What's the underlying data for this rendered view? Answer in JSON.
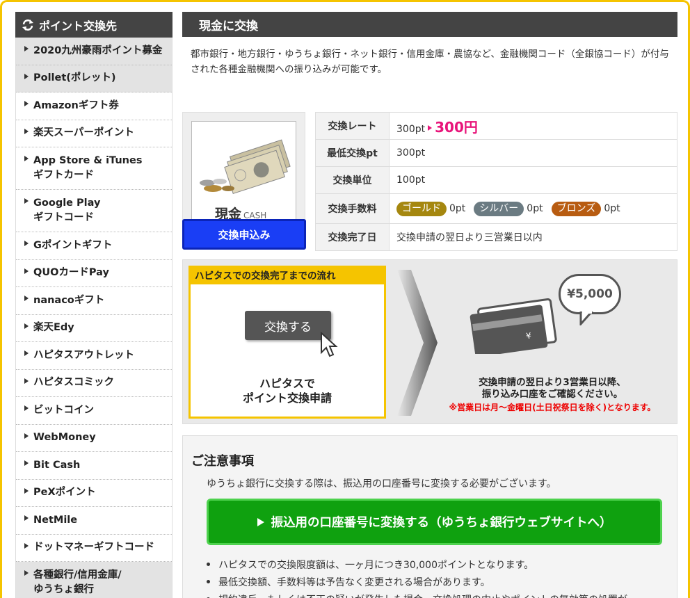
{
  "sidebar": {
    "title": "ポイント交換先",
    "items": [
      {
        "label": "2020九州豪雨ポイント募金",
        "active": true
      },
      {
        "label": "Pollet(ポレット)",
        "active": true
      },
      {
        "label": "Amazonギフト券",
        "active": false
      },
      {
        "label": "楽天スーパーポイント",
        "active": false
      },
      {
        "label": "App Store & iTunes\nギフトカード",
        "active": false
      },
      {
        "label": "Google Play\nギフトコード",
        "active": false
      },
      {
        "label": "Gポイントギフト",
        "active": false
      },
      {
        "label": "QUOカードPay",
        "active": false
      },
      {
        "label": "nanacoギフト",
        "active": false
      },
      {
        "label": "楽天Edy",
        "active": false
      },
      {
        "label": "ハピタスアウトレット",
        "active": false
      },
      {
        "label": "ハピタスコミック",
        "active": false
      },
      {
        "label": "ビットコイン",
        "active": false
      },
      {
        "label": "WebMoney",
        "active": false
      },
      {
        "label": "Bit Cash",
        "active": false
      },
      {
        "label": "PeXポイント",
        "active": false
      },
      {
        "label": "NetMile",
        "active": false
      },
      {
        "label": "ドットマネーギフトコード",
        "active": false
      },
      {
        "label": "各種銀行/信用金庫/\nゆうちょ銀行",
        "active": true
      }
    ]
  },
  "main": {
    "title": "現金に交換",
    "description": "都市銀行・地方銀行・ゆうちょ銀行・ネット銀行・信用金庫・農協など、金融機関コード（全銀協コード）が付与された各種金融機関への振り込みが可能です。",
    "cash_label": "現金",
    "cash_sub": "CASH",
    "apply_button": "交換申込み",
    "rate_table": {
      "rate_label": "交換レート",
      "rate_from": "300pt",
      "rate_to": "300円",
      "min_label": "最低交換pt",
      "min_value": "300pt",
      "unit_label": "交換単位",
      "unit_value": "100pt",
      "fee_label": "交換手数料",
      "fees": [
        {
          "tier": "ゴールド",
          "value": "0pt"
        },
        {
          "tier": "シルバー",
          "value": "0pt"
        },
        {
          "tier": "ブロンズ",
          "value": "0pt"
        }
      ],
      "done_label": "交換完了日",
      "done_value": "交換申請の翌日より三営業日以内"
    }
  },
  "flow": {
    "card_title": "ハピタスでの交換完了までの流れ",
    "swap_button": "交換する",
    "card_text": "ハピタスで\nポイント交換申請",
    "bubble": "¥5,000",
    "right_text": "交換申請の翌日より3営業日以降、\n振り込み口座をご確認ください。",
    "note": "※営業日は月～金曜日(土日祝祭日を除く)となります。"
  },
  "notes": {
    "title": "ご注意事項",
    "lead": "ゆうちょ銀行に交換する際は、振込用の口座番号に変換する必要がございます。",
    "button": "振込用の口座番号に変換する（ゆうちょ銀行ウェブサイトへ）",
    "items": [
      "ハピタスでの交換限度額は、一ヶ月につき30,000ポイントとなります。",
      "最低交換額、手数料等は予告なく変更される場合があります。",
      "規約違反、もしくは不正の疑いが発生した場合、交換処理の中止やポイントの無効等の処置が"
    ]
  },
  "colors": {
    "accent_yellow": "#f5c400",
    "header_dark": "#444444",
    "rate_pink": "#e8157a",
    "apply_blue": "#1a3ef5",
    "green": "#0fa10f"
  }
}
